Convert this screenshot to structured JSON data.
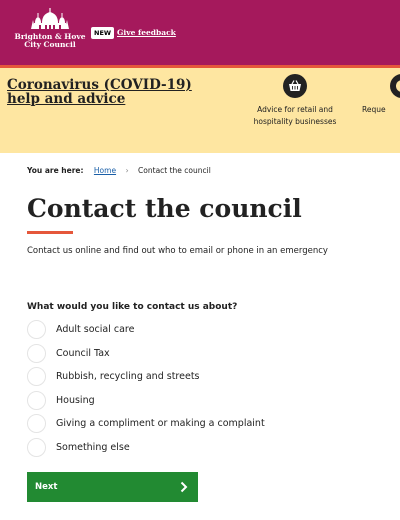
{
  "header": {
    "logo_line1": "Brighton & Hove",
    "logo_line2": "City Council",
    "new_badge": "NEW",
    "feedback_link": "Give feedback",
    "background": "#a5195c",
    "accent": "#e5573b"
  },
  "covid_banner": {
    "title": "Coronavirus (COVID-19) help and advice",
    "background": "#fee6a1",
    "items": [
      {
        "label": "Advice for retail and hospitality businesses",
        "icon": "shopping-basket-icon"
      },
      {
        "label": "Reque",
        "icon": "circle-icon"
      }
    ]
  },
  "breadcrumb": {
    "prefix": "You are here:",
    "home": "Home",
    "separator": "›",
    "current": "Contact the council"
  },
  "page": {
    "title": "Contact the council",
    "lead": "Contact us online and find out who to email or phone in an emergency"
  },
  "form": {
    "question": "What would you like to contact us about?",
    "options": [
      "Adult social care",
      "Council Tax",
      "Rubbish, recycling and streets",
      "Housing",
      "Giving a compliment or making a complaint",
      "Something else"
    ],
    "next_label": "Next",
    "next_color": "#228a32"
  }
}
